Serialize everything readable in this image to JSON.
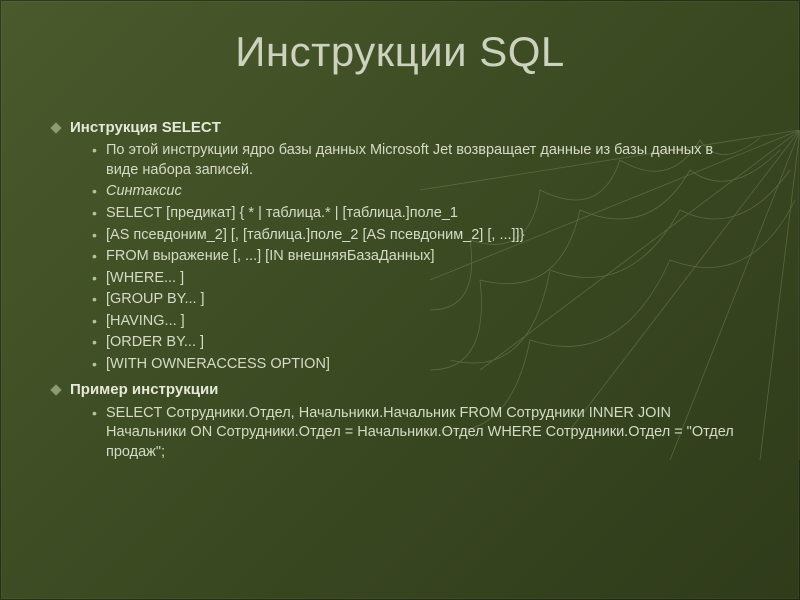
{
  "title": "Инструкции SQL",
  "sections": [
    {
      "heading": "Инструкция SELECT",
      "bullets": [
        {
          "text": "По этой инструкции ядро базы данных Microsoft Jet возвращает данные из базы данных в виде набора записей."
        },
        {
          "text": "Синтаксис",
          "italic": true
        },
        {
          "text": "SELECT [предикат] { * | таблица.* | [таблица.]поле_1"
        },
        {
          "text": "[AS псевдоним_2] [, [таблица.]поле_2 [AS псевдоним_2] [, ...]]}"
        },
        {
          "text": "FROM выражение [, ...] [IN внешняяБазаДанных]"
        },
        {
          "text": "[WHERE... ]"
        },
        {
          "text": "[GROUP BY... ]"
        },
        {
          "text": "[HAVING... ]"
        },
        {
          "text": "[ORDER BY... ]"
        },
        {
          "text": "[WITH OWNERACCESS OPTION]"
        }
      ]
    },
    {
      "heading": "Пример инструкции",
      "bullets": [
        {
          "text": "SELECT Сотрудники.Отдел, Начальники.Начальник FROM Сотрудники INNER JOIN Начальники ON Сотрудники.Отдел = Начальники.Отдел WHERE Сотрудники.Отдел = \"Отдел продаж\";"
        }
      ]
    }
  ]
}
